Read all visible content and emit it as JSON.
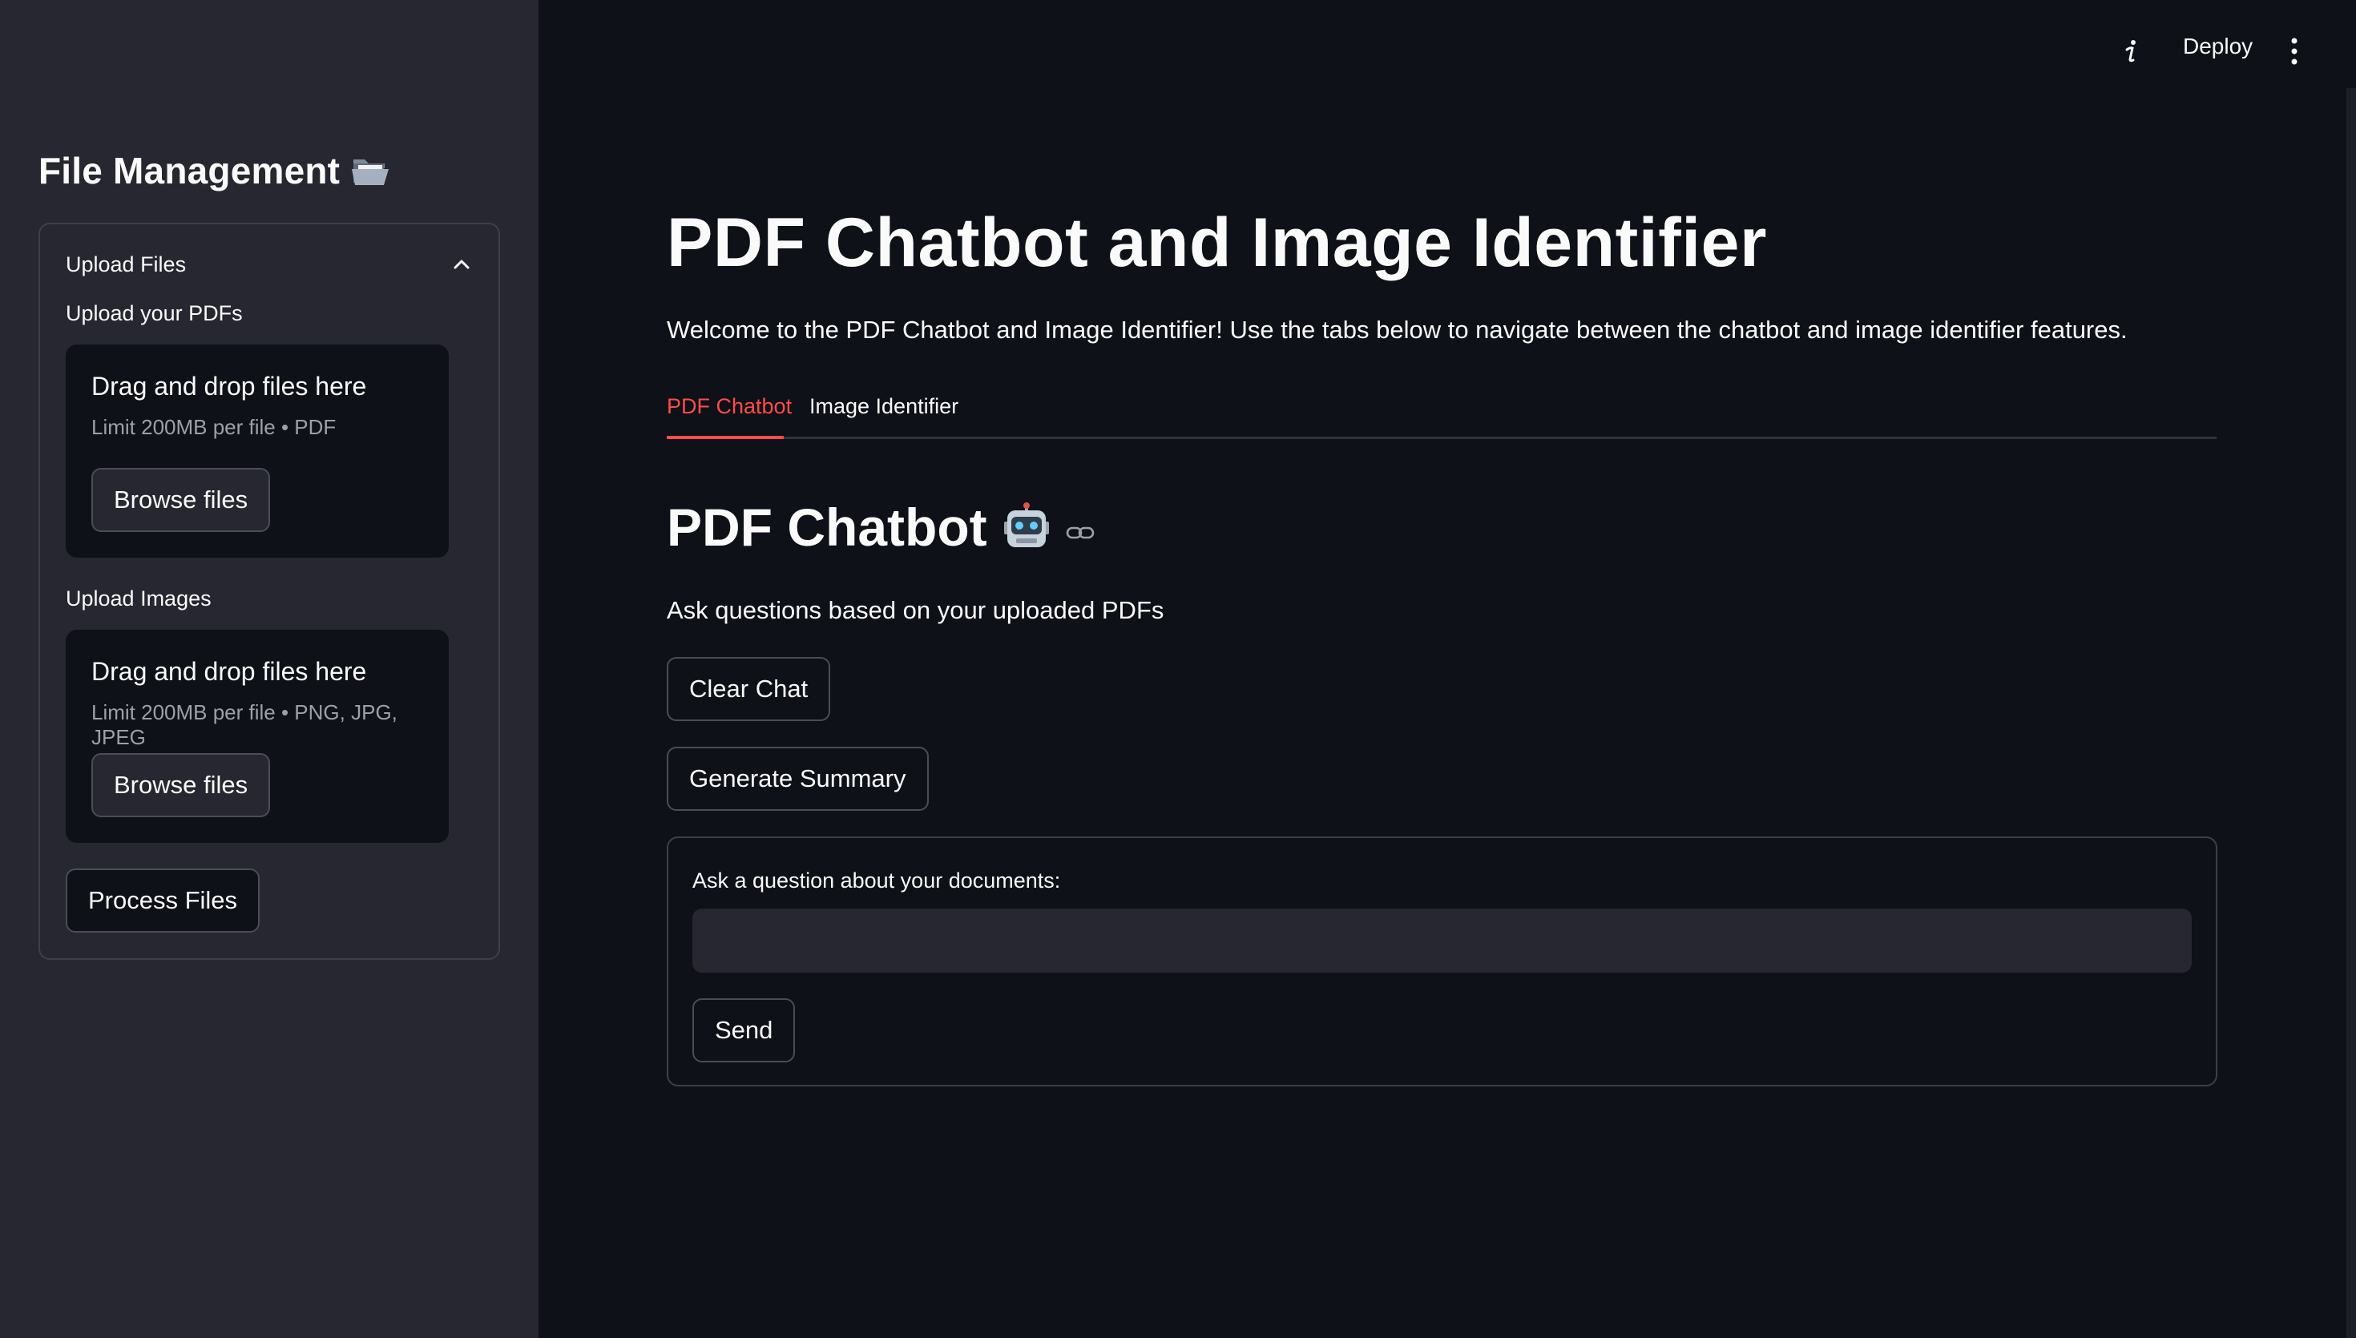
{
  "header": {
    "deploy_label": "Deploy"
  },
  "sidebar": {
    "title": "File Management",
    "expander": {
      "label": "Upload Files",
      "pdf_label": "Upload your PDFs",
      "pdf_drop": {
        "title": "Drag and drop files here",
        "limit": "Limit 200MB per file • PDF",
        "button": "Browse files"
      },
      "image_label": "Upload Images",
      "image_drop": {
        "title": "Drag and drop files here",
        "limit": "Limit 200MB per file • PNG, JPG, JPEG",
        "button": "Browse files"
      },
      "process_button": "Process Files"
    }
  },
  "main": {
    "title": "PDF Chatbot and Image Identifier",
    "welcome": "Welcome to the PDF Chatbot and Image Identifier! Use the tabs below to navigate between the chatbot and image identifier features.",
    "tabs": [
      {
        "label": "PDF Chatbot",
        "active": true
      },
      {
        "label": "Image Identifier",
        "active": false
      }
    ],
    "section_title": "PDF Chatbot",
    "section_subtitle": "Ask questions based on your uploaded PDFs",
    "clear_button": "Clear Chat",
    "summary_button": "Generate Summary",
    "form": {
      "label": "Ask a question about your documents:",
      "value": "",
      "send_button": "Send"
    }
  },
  "colors": {
    "background": "#0e1117",
    "sidebar": "#262730",
    "accent": "#ff4b4b",
    "text": "#fafafa"
  }
}
